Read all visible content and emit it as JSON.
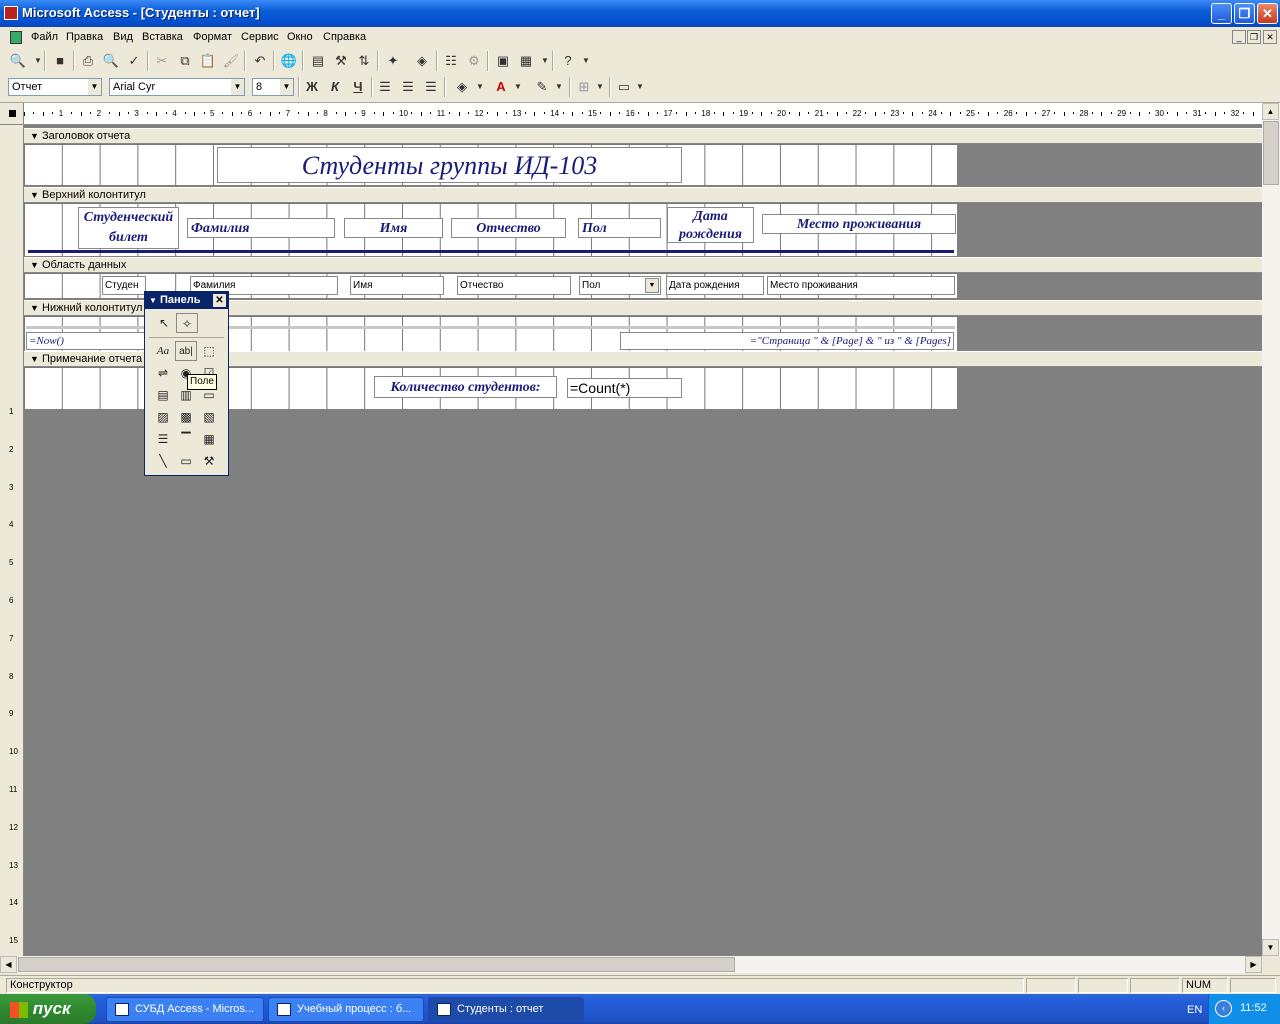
{
  "window": {
    "title": "Microsoft Access - [Студенты : отчет]",
    "caption_buttons": [
      "_",
      "❐",
      "✕"
    ]
  },
  "menu": {
    "items": [
      "Файл",
      "Правка",
      "Вид",
      "Вставка",
      "Формат",
      "Сервис",
      "Окно",
      "Справка"
    ]
  },
  "format_toolbar": {
    "object_combo": "Отчет",
    "font_combo": "Arial Cyr",
    "size_combo": "8",
    "bold": "Ж",
    "italic": "К",
    "underline": "Ч"
  },
  "ruler": {
    "h_numbers": [
      "1",
      "2",
      "3",
      "4",
      "5",
      "6",
      "7",
      "8",
      "9",
      "10",
      "11",
      "12",
      "13",
      "14",
      "15",
      "16",
      "17",
      "18",
      "19",
      "20",
      "21",
      "22",
      "23",
      "24",
      "25",
      "26",
      "27",
      "28",
      "29",
      "30",
      "31",
      "32"
    ],
    "v_numbers": [
      "1",
      "2",
      "3",
      "4",
      "5",
      "6",
      "7",
      "8",
      "9",
      "10",
      "11",
      "12",
      "13",
      "14",
      "15"
    ]
  },
  "sections": {
    "report_header": "Заголовок отчета",
    "page_header": "Верхний колонтитул",
    "detail": "Область данных",
    "page_footer": "Нижний колонтитул",
    "report_footer": "Примечание отчета"
  },
  "report": {
    "title": "Студенты группы ИД-103",
    "header_labels": {
      "student_card": "Студенческий билет",
      "surname": "Фамилия",
      "name": "Имя",
      "patronymic": "Отчество",
      "gender": "Пол",
      "birthdate": "Дата рождения",
      "residence": "Место проживания"
    },
    "detail_fields": {
      "student_card": "Студен",
      "surname": "Фамилия",
      "name": "Имя",
      "patronymic": "Отчество",
      "gender": "Пол",
      "birthdate": "Дата рождения",
      "residence": "Место проживания"
    },
    "footer": {
      "now": "=Now()",
      "page_expr": "=\"Страница \" & [Page] & \" из \" & [Pages]"
    },
    "summary": {
      "label": "Количество студентов:",
      "count": "=Count(*)"
    }
  },
  "toolbox": {
    "title": "Панель",
    "tooltip": "Поле"
  },
  "status": {
    "mode": "Конструктор",
    "num": "NUM"
  },
  "taskbar": {
    "start": "пуск",
    "items": [
      "СУБД Access - Micros...",
      "Учебный процесс : б...",
      "Студенты : отчет"
    ],
    "lang": "EN",
    "clock": "11:52"
  }
}
